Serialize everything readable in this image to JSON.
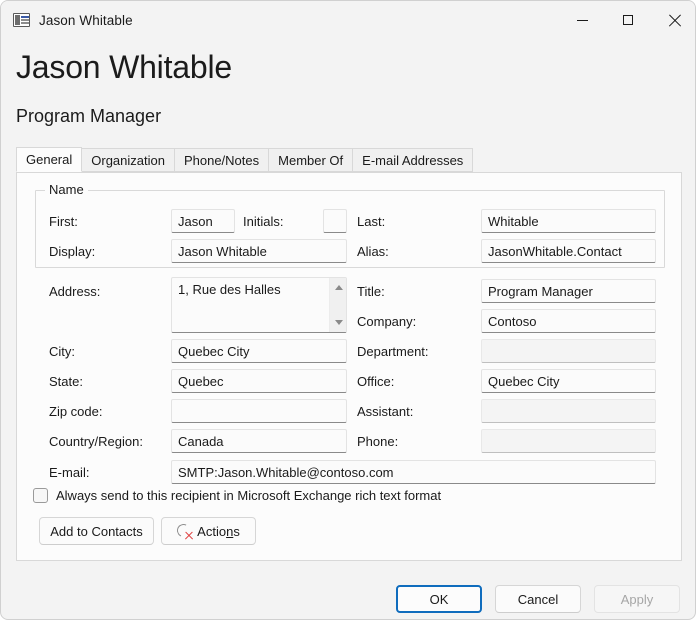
{
  "window": {
    "title": "Jason Whitable",
    "icon": "contact-card-icon",
    "minimize_label": "Minimize",
    "maximize_label": "Maximize",
    "close_label": "Close"
  },
  "header": {
    "name": "Jason Whitable",
    "job_title": "Program Manager"
  },
  "tabs": [
    {
      "label": "General",
      "active": true
    },
    {
      "label": "Organization",
      "active": false
    },
    {
      "label": "Phone/Notes",
      "active": false
    },
    {
      "label": "Member Of",
      "active": false
    },
    {
      "label": "E-mail Addresses",
      "active": false
    }
  ],
  "name_group": {
    "legend": "Name",
    "first_label": "First:",
    "first_value": "Jason",
    "initials_label": "Initials:",
    "initials_value": "",
    "last_label": "Last:",
    "last_value": "Whitable",
    "display_label": "Display:",
    "display_value": "Jason Whitable",
    "alias_label": "Alias:",
    "alias_value": "JasonWhitable.Contact"
  },
  "left_column": {
    "address_label": "Address:",
    "address_value": "1, Rue des Halles",
    "city_label": "City:",
    "city_value": "Quebec City",
    "state_label": "State:",
    "state_value": "Quebec",
    "zip_label": "Zip code:",
    "zip_value": "",
    "country_label": "Country/Region:",
    "country_value": "Canada"
  },
  "right_column": {
    "title_label": "Title:",
    "title_value": "Program Manager",
    "company_label": "Company:",
    "company_value": "Contoso",
    "department_label": "Department:",
    "department_value": "",
    "office_label": "Office:",
    "office_value": "Quebec City",
    "assistant_label": "Assistant:",
    "assistant_value": "",
    "phone_label": "Phone:",
    "phone_value": ""
  },
  "email": {
    "label": "E-mail:",
    "value": "SMTP:Jason.Whitable@contoso.com"
  },
  "rich_text_checkbox": {
    "label": "Always send to this recipient in Microsoft Exchange rich text format",
    "checked": false
  },
  "action_buttons": {
    "add_to_contacts": "Add to Contacts",
    "actions_prefix": "Actio",
    "actions_mnemonic": "n",
    "actions_suffix": "s",
    "actions_icon": "broken-image-icon"
  },
  "footer": {
    "ok": "OK",
    "cancel": "Cancel",
    "apply": "Apply",
    "apply_enabled": false
  },
  "colors": {
    "accent": "#0f6cbd",
    "dialog_bg": "#f3f3f3",
    "panel_bg": "#fcfcfc",
    "text": "#1a1a1a",
    "disabled_text": "#a6a6a6",
    "error_red": "#e04545"
  }
}
